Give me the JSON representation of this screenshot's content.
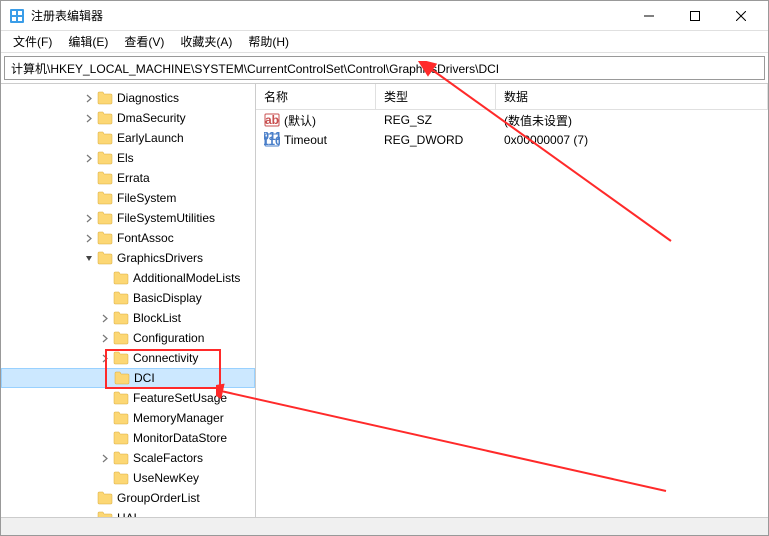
{
  "window": {
    "title": "注册表编辑器"
  },
  "menu": {
    "file": "文件(F)",
    "edit": "编辑(E)",
    "view": "查看(V)",
    "favorites": "收藏夹(A)",
    "help": "帮助(H)"
  },
  "address": "计算机\\HKEY_LOCAL_MACHINE\\SYSTEM\\CurrentControlSet\\Control\\GraphicsDrivers\\DCI",
  "tree": [
    {
      "indent": 5,
      "label": "Diagnostics",
      "exp": "closed"
    },
    {
      "indent": 5,
      "label": "DmaSecurity",
      "exp": "closed"
    },
    {
      "indent": 5,
      "label": "EarlyLaunch",
      "exp": "none"
    },
    {
      "indent": 5,
      "label": "Els",
      "exp": "closed"
    },
    {
      "indent": 5,
      "label": "Errata",
      "exp": "none"
    },
    {
      "indent": 5,
      "label": "FileSystem",
      "exp": "none"
    },
    {
      "indent": 5,
      "label": "FileSystemUtilities",
      "exp": "closed"
    },
    {
      "indent": 5,
      "label": "FontAssoc",
      "exp": "closed"
    },
    {
      "indent": 5,
      "label": "GraphicsDrivers",
      "exp": "open"
    },
    {
      "indent": 6,
      "label": "AdditionalModeLists",
      "exp": "none"
    },
    {
      "indent": 6,
      "label": "BasicDisplay",
      "exp": "none"
    },
    {
      "indent": 6,
      "label": "BlockList",
      "exp": "closed"
    },
    {
      "indent": 6,
      "label": "Configuration",
      "exp": "closed"
    },
    {
      "indent": 6,
      "label": "Connectivity",
      "exp": "closed"
    },
    {
      "indent": 6,
      "label": "DCI",
      "exp": "none",
      "selected": true
    },
    {
      "indent": 6,
      "label": "FeatureSetUsage",
      "exp": "none"
    },
    {
      "indent": 6,
      "label": "MemoryManager",
      "exp": "none"
    },
    {
      "indent": 6,
      "label": "MonitorDataStore",
      "exp": "none"
    },
    {
      "indent": 6,
      "label": "ScaleFactors",
      "exp": "closed"
    },
    {
      "indent": 6,
      "label": "UseNewKey",
      "exp": "none"
    },
    {
      "indent": 5,
      "label": "GroupOrderList",
      "exp": "none"
    },
    {
      "indent": 5,
      "label": "HAL",
      "exp": "none"
    }
  ],
  "columns": {
    "name": "名称",
    "type": "类型",
    "data": "数据"
  },
  "values": [
    {
      "name": "(默认)",
      "type": "REG_SZ",
      "data": "(数值未设置)",
      "kind": "sz"
    },
    {
      "name": "Timeout",
      "type": "REG_DWORD",
      "data": "0x00000007 (7)",
      "kind": "dword"
    }
  ]
}
